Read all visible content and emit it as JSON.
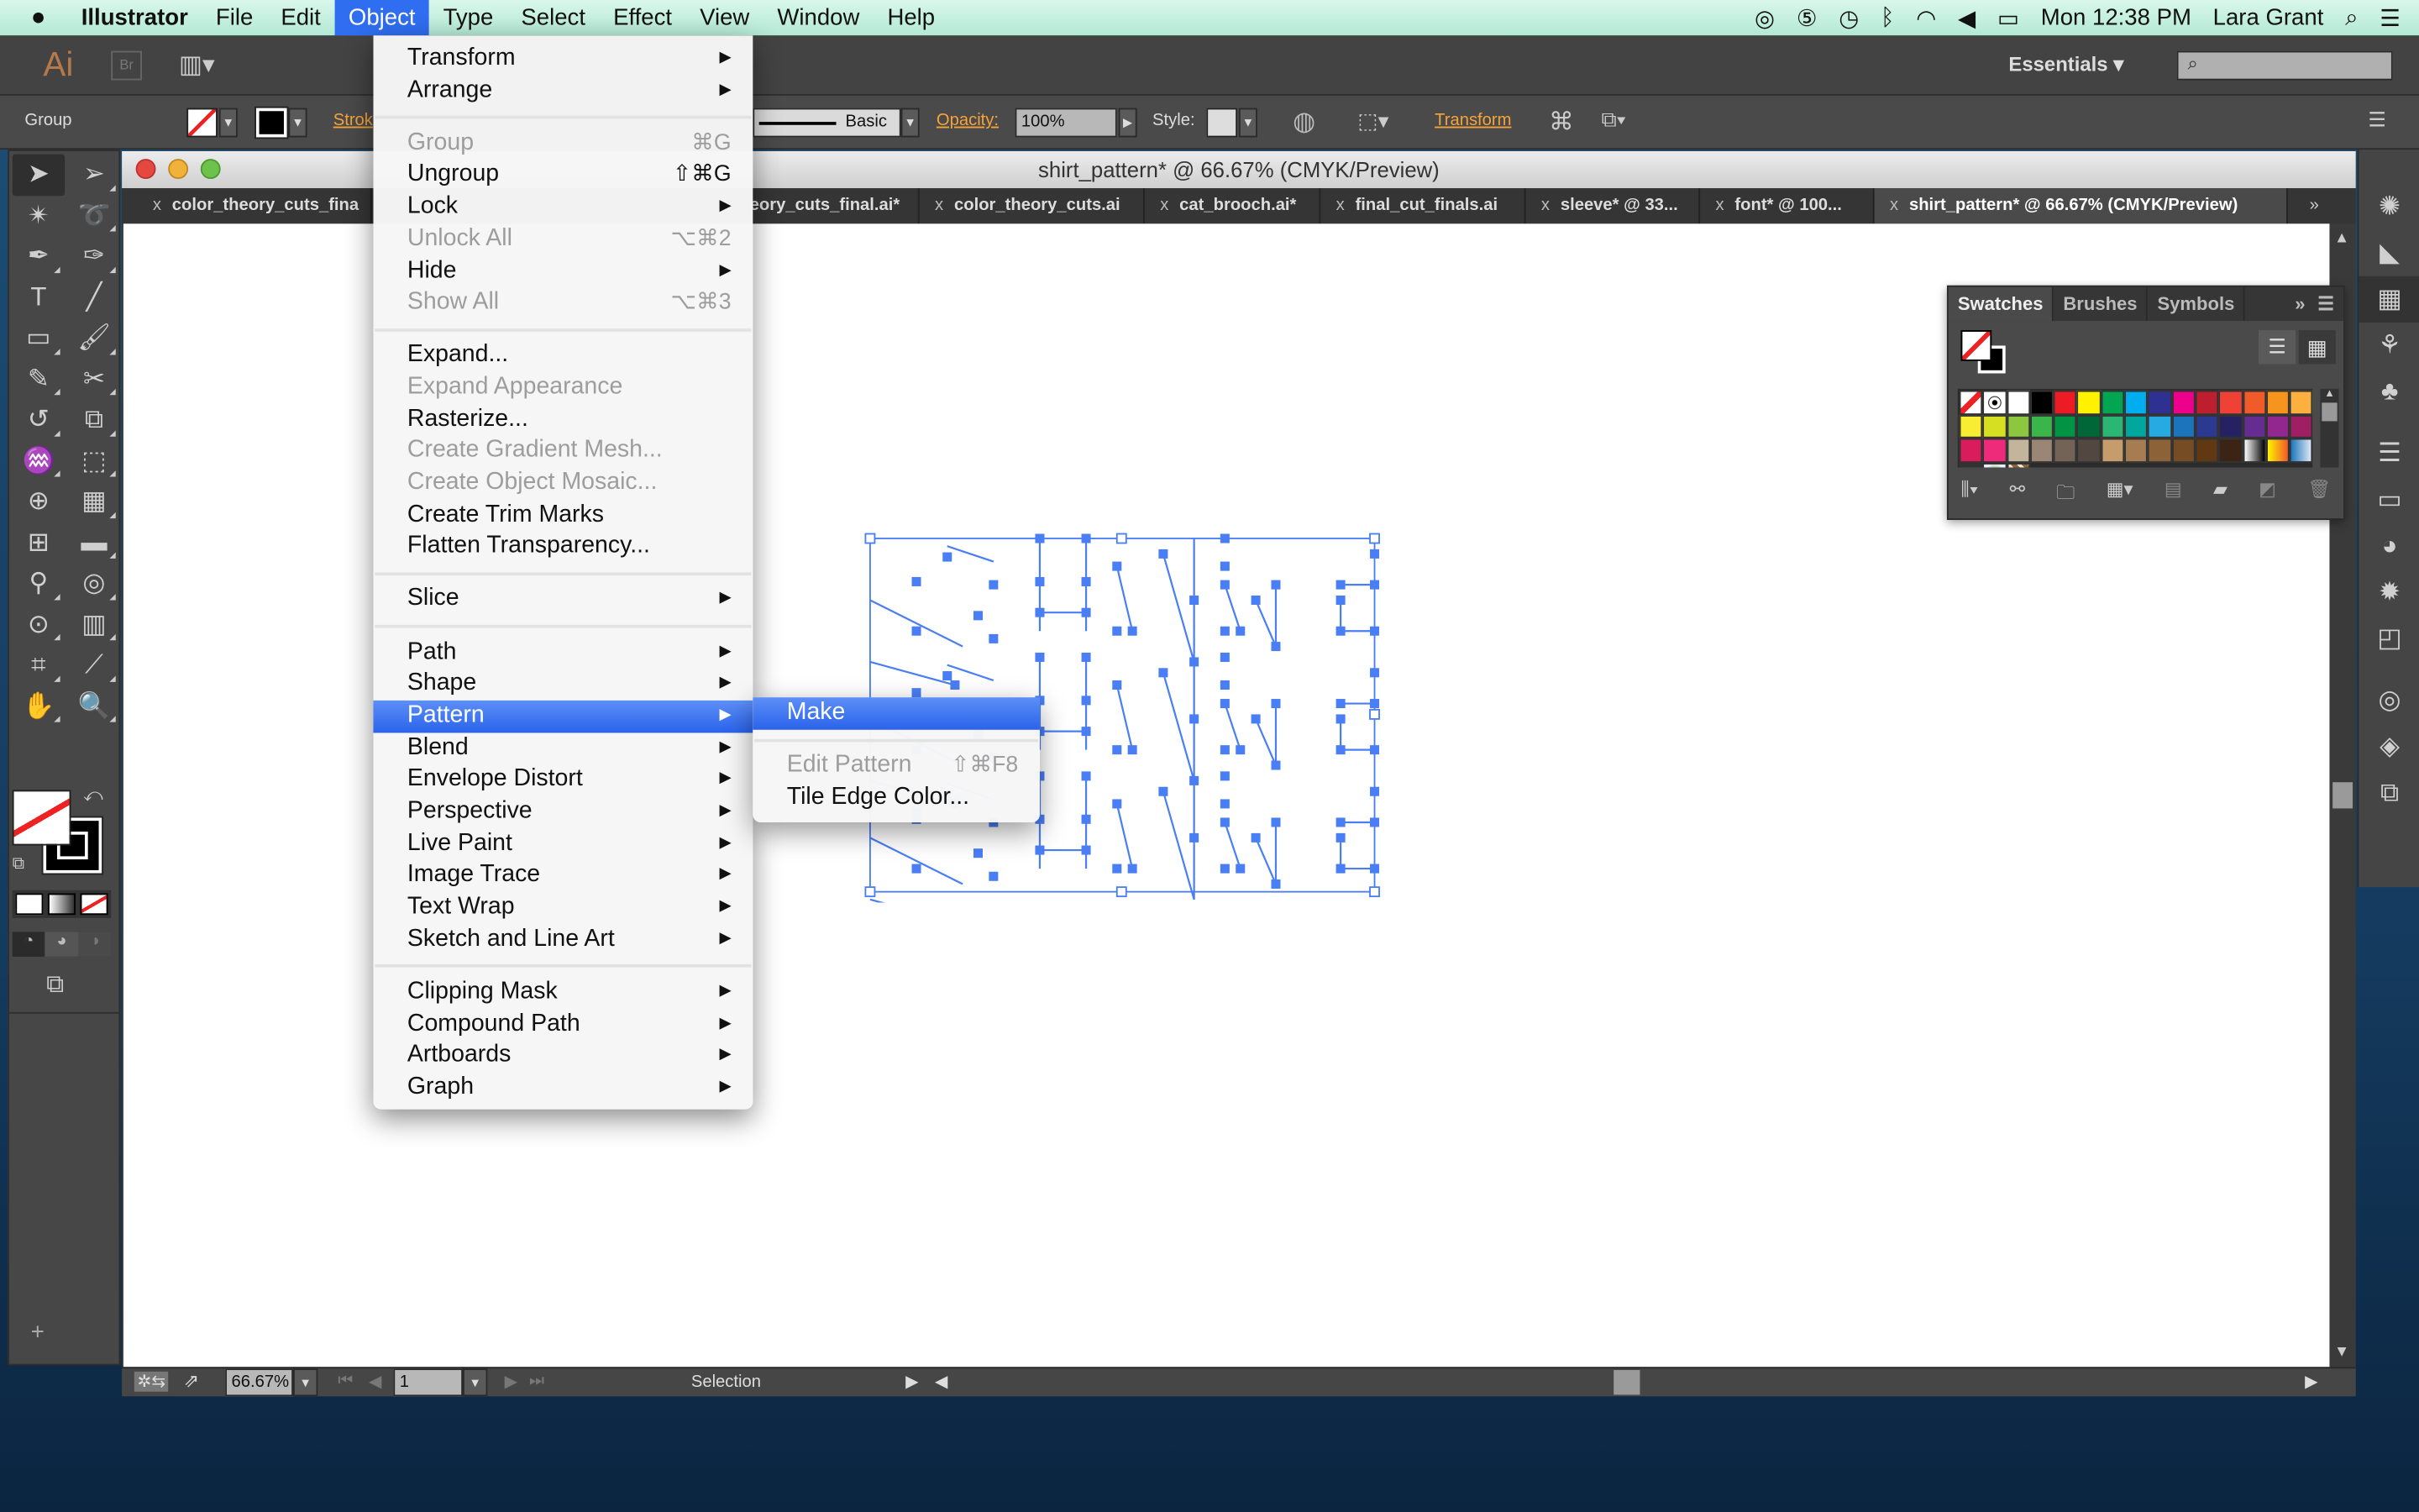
{
  "menubar": {
    "app": "Illustrator",
    "items": [
      "File",
      "Edit",
      "Object",
      "Type",
      "Select",
      "Effect",
      "View",
      "Window",
      "Help"
    ],
    "active": "Object",
    "clock": "Mon 12:38 PM",
    "user": "Lara Grant"
  },
  "appbar": {
    "logo": "Ai",
    "bridge": "Br",
    "workspace": "Essentials",
    "search_placeholder": ""
  },
  "control": {
    "selection": "Group",
    "stroke_label": "Strok",
    "profile": "Basic",
    "opacity_label": "Opacity:",
    "opacity": "100%",
    "style_label": "Style:",
    "transform": "Transform"
  },
  "document": {
    "title": "shirt_pattern* @ 66.67% (CMYK/Preview)",
    "tabs": [
      {
        "label": "color_theory_cuts_fina"
      },
      {
        "label": ""
      },
      {
        "label": "eory_cuts_final.ai*"
      },
      {
        "label": "color_theory_cuts.ai"
      },
      {
        "label": "cat_brooch.ai*"
      },
      {
        "label": "final_cut_finals.ai"
      },
      {
        "label": "sleeve* @ 33..."
      },
      {
        "label": "font* @ 100..."
      },
      {
        "label": "shirt_pattern* @ 66.67% (CMYK/Preview)",
        "active": true
      }
    ],
    "selection_color": "#4a7ef5"
  },
  "statusbar": {
    "zoom": "66.67%",
    "artboard": "1",
    "tool": "Selection"
  },
  "object_menu": [
    {
      "label": "Transform",
      "submenu": true
    },
    {
      "label": "Arrange",
      "submenu": true
    },
    {
      "sep": true
    },
    {
      "label": "Group",
      "shortcut": "⌘G",
      "disabled": true
    },
    {
      "label": "Ungroup",
      "shortcut": "⇧⌘G"
    },
    {
      "label": "Lock",
      "submenu": true
    },
    {
      "label": "Unlock All",
      "shortcut": "⌥⌘2",
      "disabled": true
    },
    {
      "label": "Hide",
      "submenu": true
    },
    {
      "label": "Show All",
      "shortcut": "⌥⌘3",
      "disabled": true
    },
    {
      "sep": true
    },
    {
      "label": "Expand..."
    },
    {
      "label": "Expand Appearance",
      "disabled": true
    },
    {
      "label": "Rasterize..."
    },
    {
      "label": "Create Gradient Mesh...",
      "disabled": true
    },
    {
      "label": "Create Object Mosaic...",
      "disabled": true
    },
    {
      "label": "Create Trim Marks"
    },
    {
      "label": "Flatten Transparency..."
    },
    {
      "sep": true
    },
    {
      "label": "Slice",
      "submenu": true
    },
    {
      "sep": true
    },
    {
      "label": "Path",
      "submenu": true
    },
    {
      "label": "Shape",
      "submenu": true
    },
    {
      "label": "Pattern",
      "submenu": true,
      "highlighted": true
    },
    {
      "label": "Blend",
      "submenu": true
    },
    {
      "label": "Envelope Distort",
      "submenu": true
    },
    {
      "label": "Perspective",
      "submenu": true
    },
    {
      "label": "Live Paint",
      "submenu": true
    },
    {
      "label": "Image Trace",
      "submenu": true
    },
    {
      "label": "Text Wrap",
      "submenu": true
    },
    {
      "label": "Sketch and Line Art",
      "submenu": true
    },
    {
      "sep": true
    },
    {
      "label": "Clipping Mask",
      "submenu": true
    },
    {
      "label": "Compound Path",
      "submenu": true
    },
    {
      "label": "Artboards",
      "submenu": true
    },
    {
      "label": "Graph",
      "submenu": true
    }
  ],
  "pattern_submenu": [
    {
      "label": "Make",
      "highlighted": true
    },
    {
      "sep": true
    },
    {
      "label": "Edit Pattern",
      "shortcut": "⇧⌘F8",
      "disabled": true
    },
    {
      "label": "Tile Edge Color..."
    }
  ],
  "tools": [
    "selection",
    "direct-selection",
    "magic-wand",
    "lasso",
    "pen",
    "curvature",
    "type",
    "line-segment",
    "rectangle",
    "paintbrush",
    "pencil",
    "scissors",
    "rotate",
    "scale",
    "warp",
    "free-transform",
    "shape-builder",
    "perspective-grid",
    "mesh",
    "gradient",
    "eyedropper",
    "blend",
    "symbol-sprayer",
    "column-graph",
    "artboard",
    "slice",
    "hand",
    "zoom"
  ],
  "swatches_panel": {
    "tabs": [
      "Swatches",
      "Brushes",
      "Symbols"
    ],
    "active": "Swatches",
    "colors": [
      "none",
      "registration",
      "#ffffff",
      "#000000",
      "#ed1c24",
      "#fff200",
      "#00a651",
      "#00aeef",
      "#2e3192",
      "#ec008c",
      "#be1e2d",
      "#ef4136",
      "#f15a29",
      "#f7941d",
      "#fbb040",
      "#f9ed32",
      "#d7df23",
      "#8dc63f",
      "#39b54a",
      "#009444",
      "#006838",
      "#2bb673",
      "#00a79d",
      "#27aae1",
      "#1c75bc",
      "#2b3990",
      "#262262",
      "#662d91",
      "#92278f",
      "#9e1f63",
      "#da1c5c",
      "#ee2a7b",
      "#c2b59b",
      "#998675",
      "#736357",
      "#534741",
      "#c69c6d",
      "#a67c52",
      "#8c6239",
      "#754c24",
      "#603913",
      "#3c2415",
      "gradient-gray",
      "gradient-yellow",
      "gradient-blue",
      "pattern-radial",
      "pattern-green",
      "pattern-swirl"
    ]
  },
  "right_dock": [
    "color-guide-icon",
    "color-icon",
    "swatches-icon",
    "brushes-icon",
    "symbols-icon",
    "stroke-icon",
    "gradient-icon",
    "transparency-icon",
    "appearance-icon",
    "graphic-styles-icon",
    "cc-libraries-icon",
    "layers-icon",
    "artboards-icon"
  ]
}
